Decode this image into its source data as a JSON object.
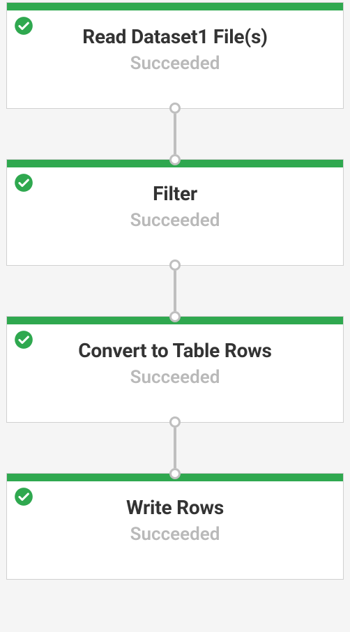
{
  "colors": {
    "success_bar": "#2fa84f",
    "border": "#d0d0d0",
    "connector": "#bfbfbf",
    "title": "#333333",
    "status": "#b9b9b9",
    "background": "#f5f5f5"
  },
  "nodes": [
    {
      "title": "Read Dataset1 File(s)",
      "status": "Succeeded",
      "icon": "check-circle"
    },
    {
      "title": "Filter",
      "status": "Succeeded",
      "icon": "check-circle"
    },
    {
      "title": "Convert to Table Rows",
      "status": "Succeeded",
      "icon": "check-circle"
    },
    {
      "title": "Write Rows",
      "status": "Succeeded",
      "icon": "check-circle"
    }
  ]
}
